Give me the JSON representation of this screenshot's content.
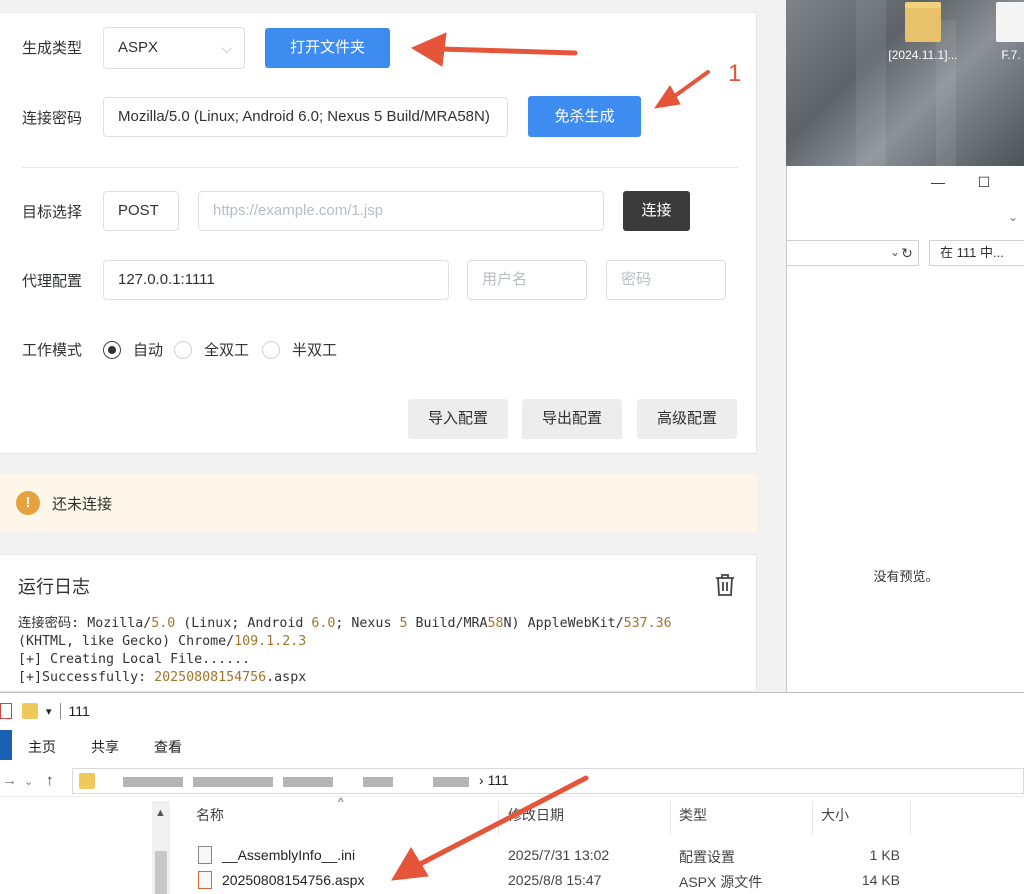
{
  "desktop": {
    "items": [
      {
        "label": "[2024.11.1]...",
        "kind": "folder"
      },
      {
        "label": "F.7.",
        "kind": "doc"
      }
    ]
  },
  "explorer_right": {
    "search_placeholder": "在 111 中...",
    "no_preview": "没有预览。",
    "controls": [
      "—",
      "☐",
      "✕"
    ]
  },
  "app": {
    "gen_type": {
      "label": "生成类型",
      "value": "ASPX",
      "open_folder": "打开文件夹"
    },
    "conn_pass": {
      "label": "连接密码",
      "value": "Mozilla/5.0 (Linux; Android 6.0; Nexus 5 Build/MRA58N)",
      "generate": "免杀生成"
    },
    "target": {
      "label": "目标选择",
      "method": "POST",
      "url_placeholder": "https://example.com/1.jsp",
      "connect": "连接"
    },
    "proxy": {
      "label": "代理配置",
      "addr": "127.0.0.1:1111",
      "user_placeholder": "用户名",
      "pass_placeholder": "密码"
    },
    "mode": {
      "label": "工作模式",
      "options": [
        "自动",
        "全双工",
        "半双工"
      ],
      "selected": "自动"
    },
    "buttons": {
      "import": "导入配置",
      "export": "导出配置",
      "advanced": "高级配置"
    },
    "alert": {
      "icon": "!",
      "text": "还未连接"
    },
    "log": {
      "title": "运行日志",
      "lines": [
        "连接密码: Mozilla/5.0 (Linux; Android 6.0; Nexus 5 Build/MRA58N) AppleWebKit/537.36",
        "(KHTML, like Gecko) Chrome/109.1.2.3",
        "[+] Creating Local File......",
        "[+]Successfully: 20250808154756.aspx"
      ]
    }
  },
  "annotation": {
    "number": "1",
    "color": "#e5553a"
  },
  "explorer": {
    "title": "111",
    "tabs": [
      "主页",
      "共享",
      "查看"
    ],
    "path_end": "111",
    "columns": [
      "名称",
      "修改日期",
      "类型",
      "大小"
    ],
    "files": [
      {
        "name": "__AssemblyInfo__.ini",
        "date": "2025/7/31 13:02",
        "type": "配置设置",
        "size": "1 KB",
        "icon": "ini"
      },
      {
        "name": "20250808154756.aspx",
        "date": "2025/8/8 15:47",
        "type": "ASPX 源文件",
        "size": "14 KB",
        "icon": "aspx"
      }
    ]
  },
  "colors": {
    "primary": "#3f8cf0",
    "dark": "#3a3a3a",
    "warning": "#e6a23c",
    "arrow": "#e5553a"
  }
}
